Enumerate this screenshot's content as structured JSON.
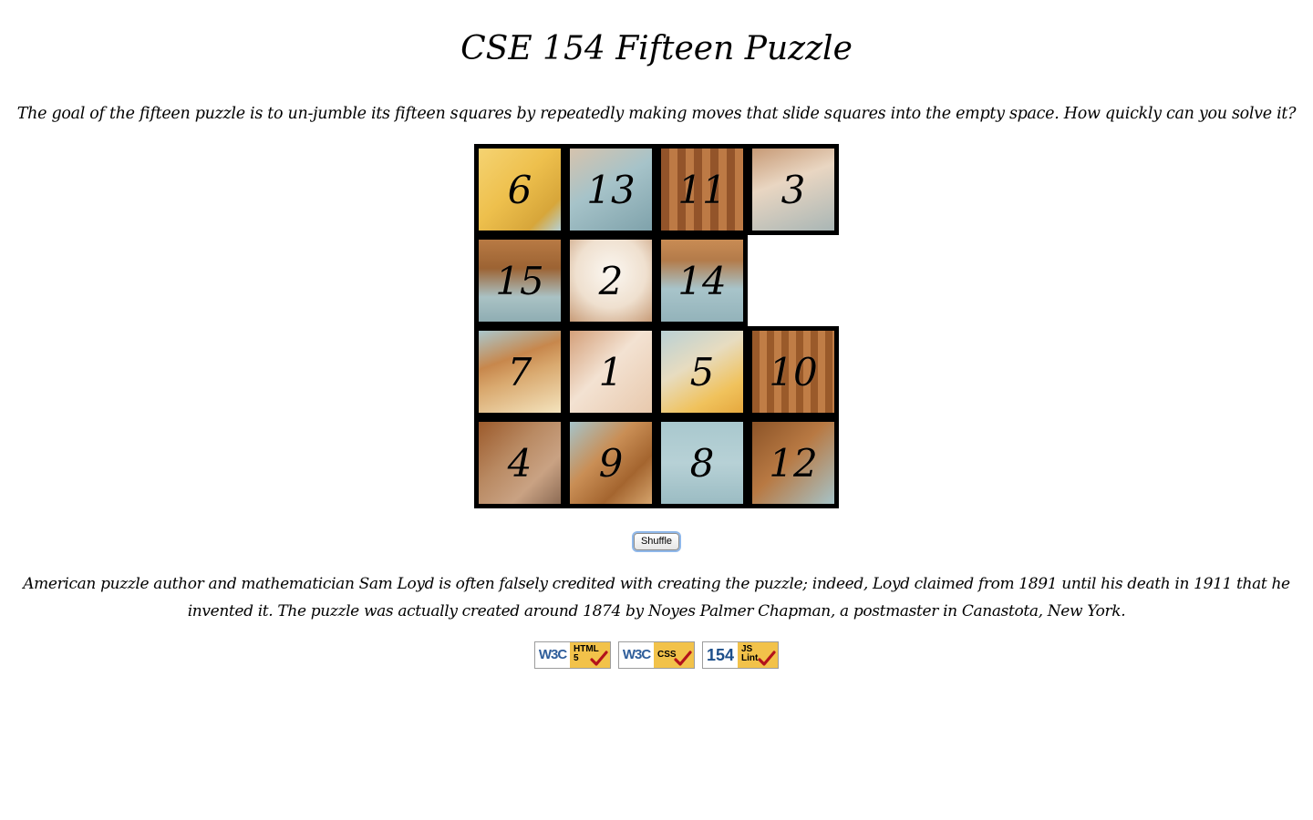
{
  "page": {
    "title": "CSE 154 Fifteen Puzzle",
    "intro": "The goal of the fifteen puzzle is to un-jumble its fifteen squares by repeatedly making moves that slide squares into the empty space. How quickly can you solve it?",
    "outro": "American puzzle author and mathematician Sam Loyd is often falsely credited with creating the puzzle; indeed, Loyd claimed from 1891 until his death in 1911 that he invented it. The puzzle was actually created around 1874 by Noyes Palmer Chapman, a postmaster in Canastota, New York."
  },
  "puzzle": {
    "tiles": [
      {
        "label": "6",
        "row": 0,
        "col": 0
      },
      {
        "label": "13",
        "row": 0,
        "col": 1
      },
      {
        "label": "11",
        "row": 0,
        "col": 2
      },
      {
        "label": "3",
        "row": 0,
        "col": 3
      },
      {
        "label": "15",
        "row": 1,
        "col": 0
      },
      {
        "label": "2",
        "row": 1,
        "col": 1
      },
      {
        "label": "14",
        "row": 1,
        "col": 2
      },
      {
        "label": "7",
        "row": 2,
        "col": 0
      },
      {
        "label": "1",
        "row": 2,
        "col": 1
      },
      {
        "label": "5",
        "row": 2,
        "col": 2
      },
      {
        "label": "10",
        "row": 2,
        "col": 3
      },
      {
        "label": "4",
        "row": 3,
        "col": 0
      },
      {
        "label": "9",
        "row": 3,
        "col": 1
      },
      {
        "label": "8",
        "row": 3,
        "col": 2
      },
      {
        "label": "12",
        "row": 3,
        "col": 3
      }
    ],
    "empty": {
      "row": 1,
      "col": 3
    }
  },
  "controls": {
    "shuffle_label": "Shuffle"
  },
  "badges": [
    {
      "name": "w3c-html5-badge",
      "left": "W3C",
      "right_line1": "HTML",
      "right_line2": "5"
    },
    {
      "name": "w3c-css-badge",
      "left": "W3C",
      "right_line1": "CSS",
      "right_line2": ""
    },
    {
      "name": "jslint-badge",
      "left": "154",
      "right_line1": "JS",
      "right_line2": "Lint"
    }
  ],
  "colors": {
    "tile_border": "#000000",
    "badge_yellow": "#f2c24a",
    "badge_blue": "#2e5d9a",
    "check_red": "#b3121b"
  }
}
